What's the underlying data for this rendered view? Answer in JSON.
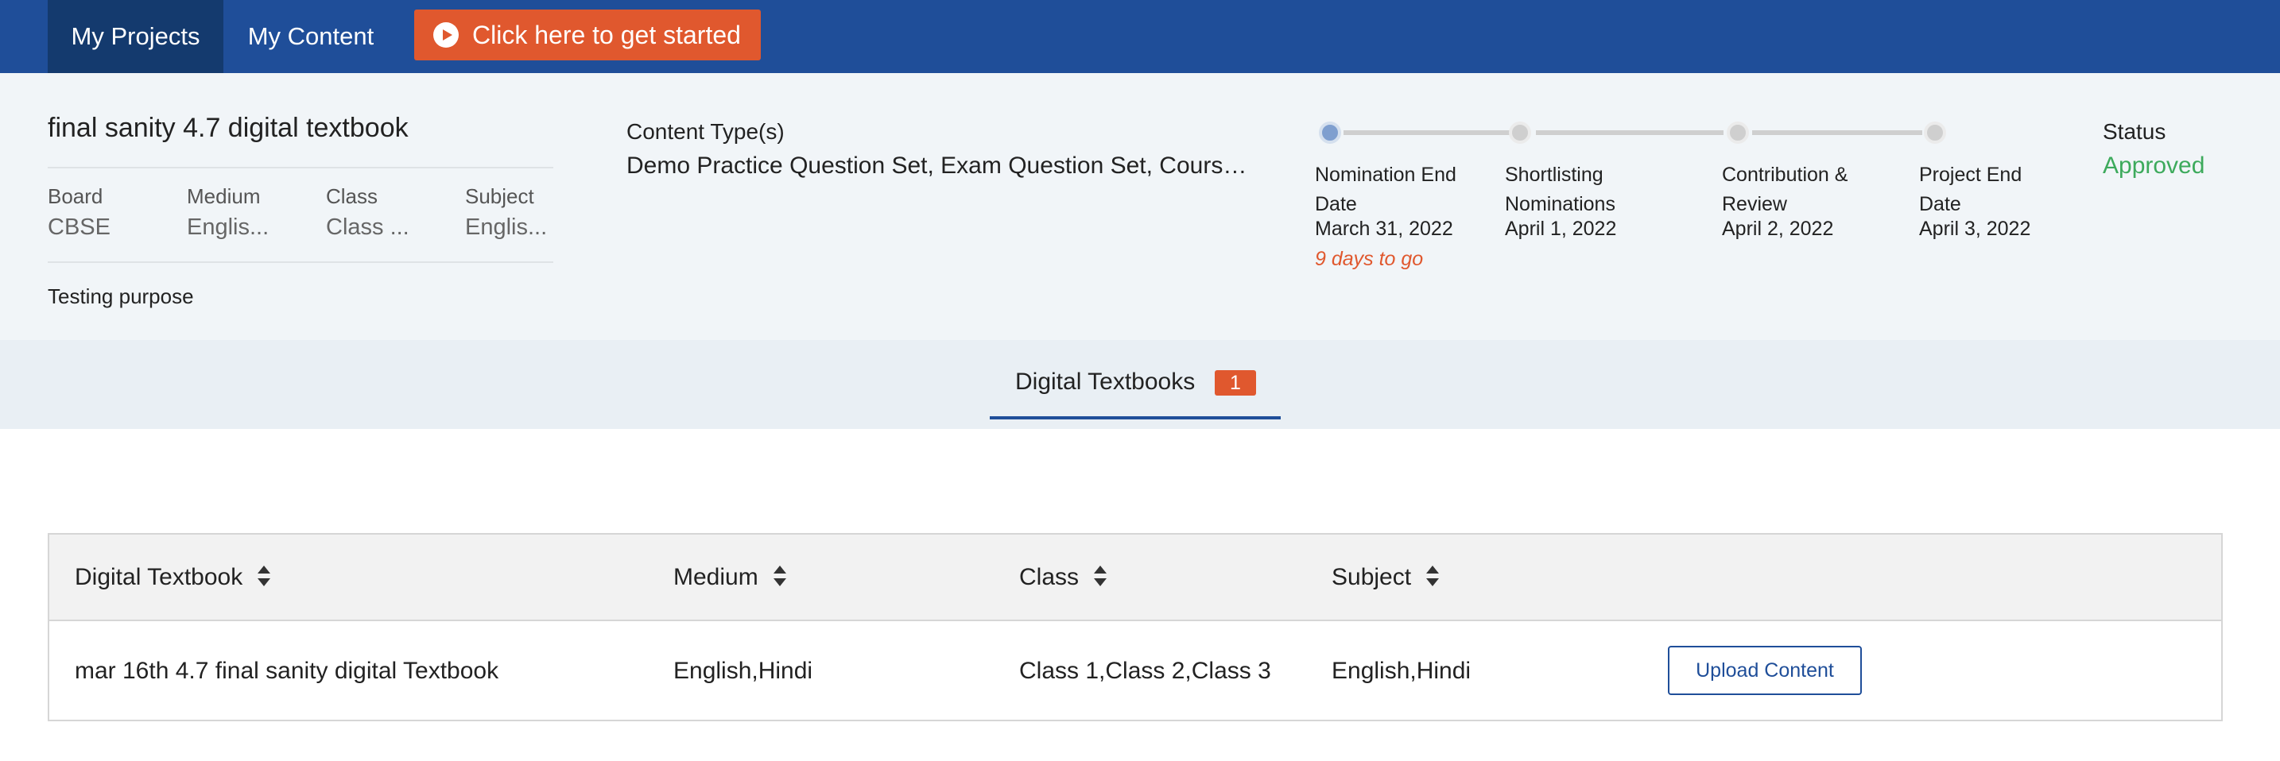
{
  "nav": {
    "tabs": [
      {
        "label": "My Projects",
        "active": true
      },
      {
        "label": "My Content",
        "active": false
      }
    ],
    "cta_label": "Click here to get started",
    "cta_icon": "play-circle-icon"
  },
  "project": {
    "title": "final sanity 4.7 digital textbook",
    "meta": [
      {
        "label": "Board",
        "value": "CBSE"
      },
      {
        "label": "Medium",
        "value": "Englis..."
      },
      {
        "label": "Class",
        "value": "Class ..."
      },
      {
        "label": "Subject",
        "value": "Englis..."
      }
    ],
    "description": "Testing purpose",
    "content_types_label": "Content Type(s)",
    "content_types_value": "Demo Practice Question Set, Exam Question Set, Course...",
    "status_label": "Status",
    "status_value": "Approved"
  },
  "timeline": {
    "steps": [
      {
        "label": "Nomination End Date",
        "date": "March 31, 2022",
        "completed": true
      },
      {
        "label": "Shortlisting Nominations",
        "date": "April 1, 2022",
        "completed": false
      },
      {
        "label": "Contribution & Review",
        "date": "April 2, 2022",
        "completed": false
      },
      {
        "label": "Project End Date",
        "date": "April 3, 2022",
        "completed": false
      }
    ],
    "remaining": "9 days to go"
  },
  "tabs": {
    "items": [
      {
        "label": "Digital Textbooks",
        "count": "1",
        "active": true
      }
    ]
  },
  "table": {
    "columns": [
      "Digital Textbook",
      "Medium",
      "Class",
      "Subject"
    ],
    "rows": [
      {
        "textbook": "mar 16th 4.7 final sanity digital Textbook",
        "medium": "English,Hindi",
        "class": "Class 1,Class 2,Class 3",
        "subject": "English,Hindi",
        "action": "Upload Content"
      }
    ]
  },
  "colors": {
    "nav_bg": "#1f4e99",
    "nav_active": "#143a6e",
    "accent_orange": "#e0582e",
    "status_green": "#3daa5c",
    "header_bg": "#f1f5f8"
  }
}
